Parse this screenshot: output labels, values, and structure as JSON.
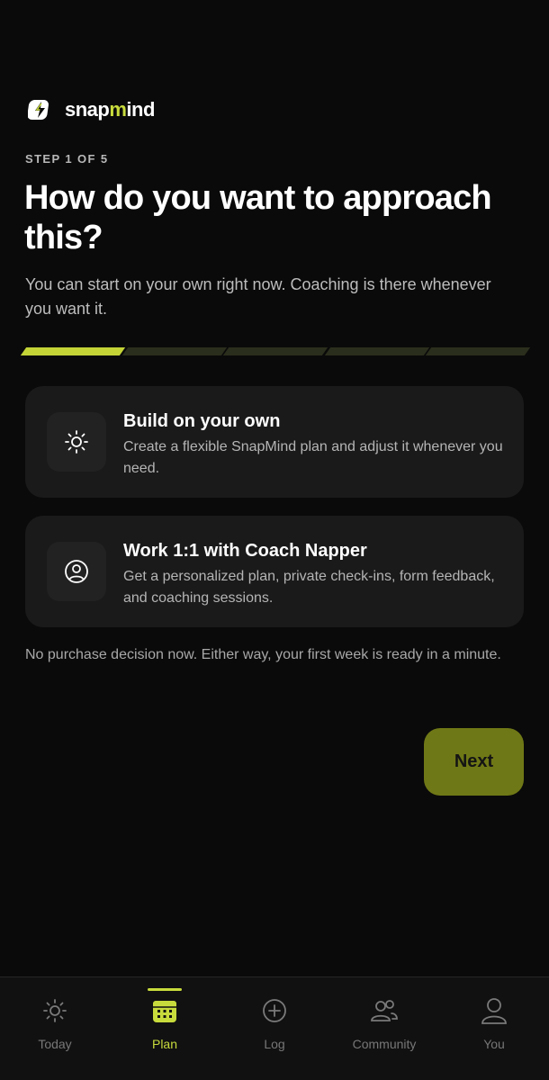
{
  "brand": {
    "name_prefix": "snap",
    "name_accent": "m",
    "name_suffix": "ind",
    "logo_icon": "lightning-bolt-icon"
  },
  "step_label": "STEP 1 OF 5",
  "title": "How do you want to approach this?",
  "subtitle": "You can start on your own right now. Coaching is there whenever you want it.",
  "progress": {
    "current": 1,
    "total": 5
  },
  "options": [
    {
      "icon": "sun-icon",
      "title": "Build on your own",
      "description": "Create a flexible SnapMind plan and adjust it whenever you need."
    },
    {
      "icon": "user-circle-icon",
      "title": "Work 1:1 with Coach Napper",
      "description": "Get a personalized plan, private check-ins, form feedback, and coaching sessions."
    }
  ],
  "note": "No purchase decision now. Either way, your first week is ready in a minute.",
  "next_label": "Next",
  "tabs": [
    {
      "label": "Today",
      "icon": "sun-icon"
    },
    {
      "label": "Plan",
      "icon": "calendar-icon",
      "active": true
    },
    {
      "label": "Log",
      "icon": "plus-circle-icon"
    },
    {
      "label": "Community",
      "icon": "users-icon"
    },
    {
      "label": "You",
      "icon": "user-icon"
    }
  ],
  "colors": {
    "accent": "#c8db3c",
    "button": "#6f7816",
    "background": "#0a0a0a",
    "card": "#1a1a1a"
  }
}
